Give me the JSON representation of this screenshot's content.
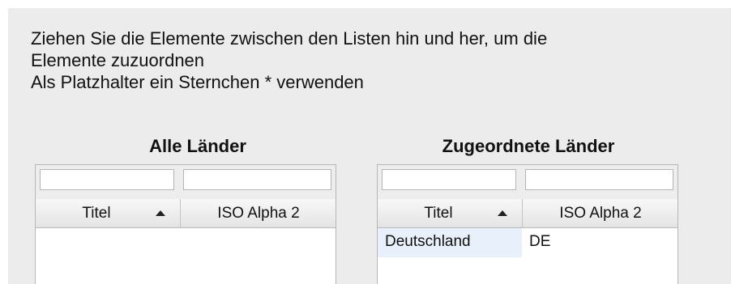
{
  "instructions": {
    "line1": "Ziehen Sie die Elemente zwischen den Listen hin und her, um die",
    "line2": "Elemente zuzuordnen",
    "line3": "Als Platzhalter ein Sternchen * verwenden"
  },
  "all_countries": {
    "title": "Alle Länder",
    "columns": {
      "title": "Titel",
      "iso": "ISO Alpha 2"
    },
    "filters": {
      "title": "",
      "iso": ""
    },
    "rows": []
  },
  "assigned_countries": {
    "title": "Zugeordnete Länder",
    "columns": {
      "title": "Titel",
      "iso": "ISO Alpha 2"
    },
    "filters": {
      "title": "",
      "iso": ""
    },
    "rows": [
      {
        "title": "Deutschland",
        "iso": "DE"
      }
    ]
  },
  "icons": {
    "sort": "sort-ascending-icon"
  }
}
